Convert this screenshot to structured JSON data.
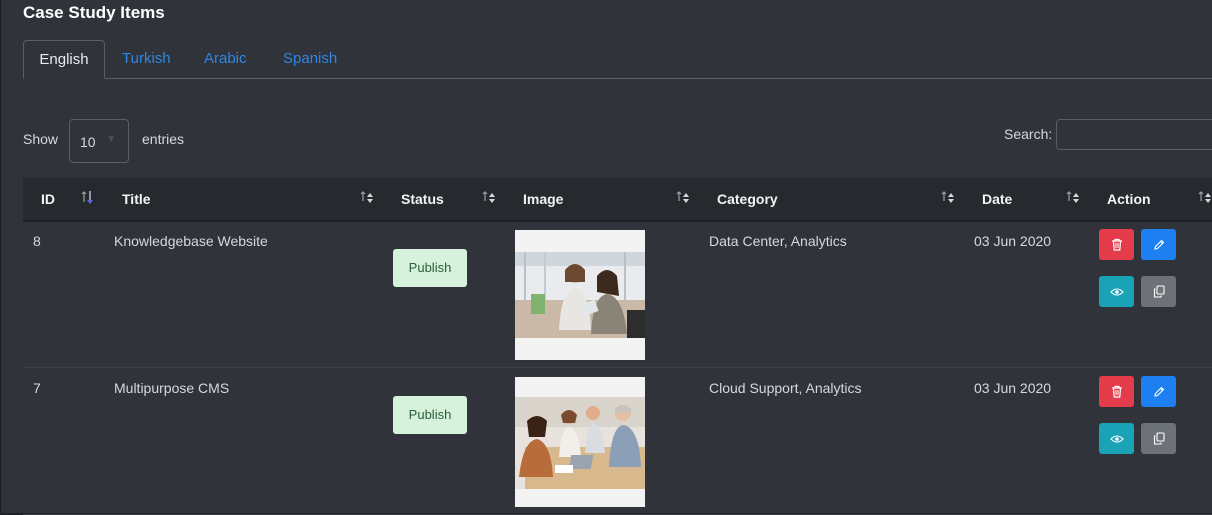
{
  "page": {
    "title": "Case Study Items"
  },
  "tabs": [
    {
      "label": "English",
      "active": true
    },
    {
      "label": "Turkish",
      "active": false
    },
    {
      "label": "Arabic",
      "active": false
    },
    {
      "label": "Spanish",
      "active": false
    }
  ],
  "controls": {
    "show_label": "Show",
    "entries_value": "10",
    "entries_label": "entries",
    "search_label": "Search:",
    "search_value": ""
  },
  "table": {
    "columns": [
      "ID",
      "Title",
      "Status",
      "Image",
      "Category",
      "Date",
      "Action"
    ],
    "rows": [
      {
        "id": "8",
        "title": "Knowledgebase Website",
        "status": "Publish",
        "image": "office-team-tablet-photo",
        "category": "Data Center, Analytics",
        "date": "03 Jun 2020"
      },
      {
        "id": "7",
        "title": "Multipurpose CMS",
        "status": "Publish",
        "image": "team-meeting-laptop-photo",
        "category": "Cloud Support, Analytics",
        "date": "03 Jun 2020"
      }
    ]
  },
  "icons": {
    "delete": "trash-icon",
    "edit": "pencil-icon",
    "view": "eye-icon",
    "duplicate": "copy-icon",
    "sort": "sort-arrows-icon"
  },
  "colors": {
    "link": "#2f86e6",
    "badge_bg": "#d7f2dc",
    "delete": "#e43c4b",
    "edit": "#1d7ff0",
    "view": "#1aa2b7",
    "duplicate": "#6d7278"
  }
}
